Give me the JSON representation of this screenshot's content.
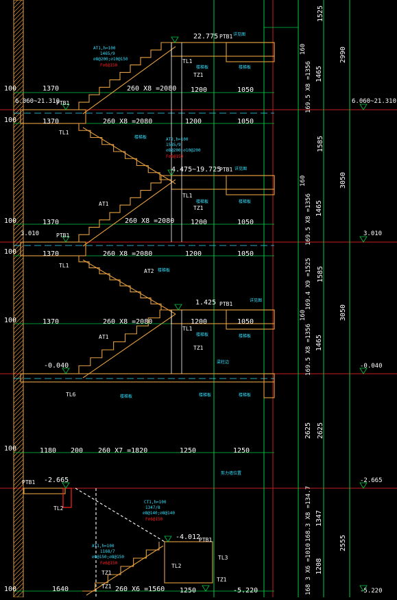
{
  "colors": {
    "background": "#000000",
    "dimension": "#ffffff",
    "structure": "#e8a040",
    "axis_green": "#00cc44",
    "axis_red": "#c81e1e",
    "note_cyan": "#33e0ff",
    "level_text": "#ffffff",
    "rebar_red": "#ff2020",
    "hatch": "#e8a040"
  },
  "levels": {
    "l1": "22.775",
    "l2": "4.475~19.725",
    "l3": "1.425",
    "l4": "-0.040",
    "l5": "-2.665",
    "l6": "-4.012",
    "l7": "-5.220",
    "left1": "6.060~21.310",
    "left2": "3.010",
    "left3": "-0.040",
    "left4": "-2.665",
    "right1": "6.060~21.310",
    "right2": "3.010",
    "right3": "-0.040",
    "right4": "-2.665",
    "right5": "-5.220"
  },
  "dims": {
    "d1370": "1370",
    "d1200": "1200",
    "d1050": "1050",
    "flight1": "260 X8 =2080",
    "flight2": "260 X7 =1820",
    "flight3": "260 X6 =1560",
    "d1180": "1180",
    "d200": "200",
    "d1250": "1250",
    "d1640": "1640",
    "d100": "100"
  },
  "right_dims": {
    "col1": [
      "1525",
      "2990",
      "1465",
      "1585",
      "3050",
      "1465",
      "1585",
      "3050",
      "1465",
      "2625",
      "2625",
      "1347",
      "2555",
      "1208"
    ],
    "col2": [
      "160",
      "169.5 X8 =1356",
      "169.5 X8 =1356",
      "160",
      "169.4 X9 =1525",
      "169.5 X8 =1356",
      "160",
      "168.3 X8 =134.7",
      "168 3 X6 =1010"
    ]
  },
  "tags": {
    "ptb1": "PTB1",
    "tl1": "TL1",
    "tl2": "TL2",
    "tl3": "TL3",
    "tl6": "TL6",
    "tz1": "TZ1",
    "at1": "AT1",
    "at2": "AT2",
    "ct1": "CT1",
    "note_beam": "详见图",
    "note_slab": "楼梯板",
    "note_edge": "梁柱边"
  },
  "notes": {
    "at1_top": [
      "AT1,h=100",
      "1465/9",
      "⌀8@200;⌀10@150",
      "F⌀6@150"
    ],
    "at2_mid": [
      "AT2,h=100",
      "1585/9",
      "⌀8@200;⌀10@200",
      "F⌀6@150"
    ],
    "ct1": [
      "CT1,h=100",
      "1347/8",
      "⌀8@140;⌀8@140",
      "F⌀6@150"
    ],
    "at1_bot": [
      "AT1,h=100",
      "1168/7",
      "⌀8@150;⌀8@150",
      "F⌀6@150"
    ],
    "bottom_note": "剪力墙位置"
  }
}
